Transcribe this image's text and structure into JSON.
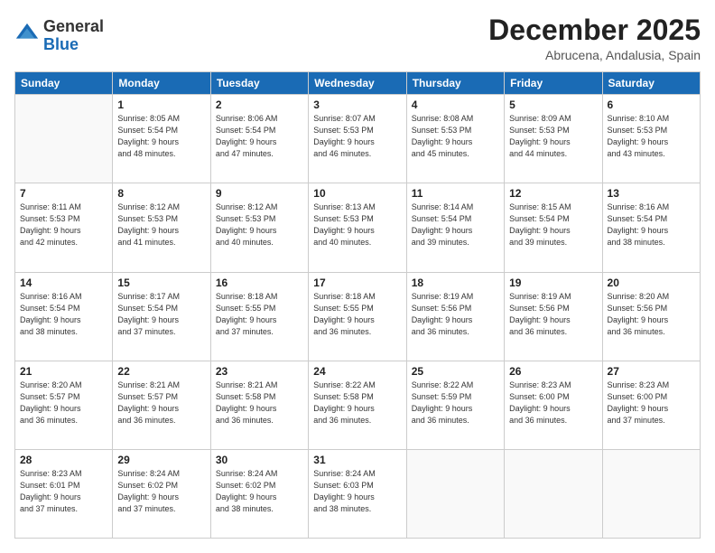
{
  "logo": {
    "general": "General",
    "blue": "Blue"
  },
  "title": "December 2025",
  "subtitle": "Abrucena, Andalusia, Spain",
  "header_days": [
    "Sunday",
    "Monday",
    "Tuesday",
    "Wednesday",
    "Thursday",
    "Friday",
    "Saturday"
  ],
  "weeks": [
    [
      {
        "day": "",
        "info": ""
      },
      {
        "day": "1",
        "info": "Sunrise: 8:05 AM\nSunset: 5:54 PM\nDaylight: 9 hours\nand 48 minutes."
      },
      {
        "day": "2",
        "info": "Sunrise: 8:06 AM\nSunset: 5:54 PM\nDaylight: 9 hours\nand 47 minutes."
      },
      {
        "day": "3",
        "info": "Sunrise: 8:07 AM\nSunset: 5:53 PM\nDaylight: 9 hours\nand 46 minutes."
      },
      {
        "day": "4",
        "info": "Sunrise: 8:08 AM\nSunset: 5:53 PM\nDaylight: 9 hours\nand 45 minutes."
      },
      {
        "day": "5",
        "info": "Sunrise: 8:09 AM\nSunset: 5:53 PM\nDaylight: 9 hours\nand 44 minutes."
      },
      {
        "day": "6",
        "info": "Sunrise: 8:10 AM\nSunset: 5:53 PM\nDaylight: 9 hours\nand 43 minutes."
      }
    ],
    [
      {
        "day": "7",
        "info": "Sunrise: 8:11 AM\nSunset: 5:53 PM\nDaylight: 9 hours\nand 42 minutes."
      },
      {
        "day": "8",
        "info": "Sunrise: 8:12 AM\nSunset: 5:53 PM\nDaylight: 9 hours\nand 41 minutes."
      },
      {
        "day": "9",
        "info": "Sunrise: 8:12 AM\nSunset: 5:53 PM\nDaylight: 9 hours\nand 40 minutes."
      },
      {
        "day": "10",
        "info": "Sunrise: 8:13 AM\nSunset: 5:53 PM\nDaylight: 9 hours\nand 40 minutes."
      },
      {
        "day": "11",
        "info": "Sunrise: 8:14 AM\nSunset: 5:54 PM\nDaylight: 9 hours\nand 39 minutes."
      },
      {
        "day": "12",
        "info": "Sunrise: 8:15 AM\nSunset: 5:54 PM\nDaylight: 9 hours\nand 39 minutes."
      },
      {
        "day": "13",
        "info": "Sunrise: 8:16 AM\nSunset: 5:54 PM\nDaylight: 9 hours\nand 38 minutes."
      }
    ],
    [
      {
        "day": "14",
        "info": "Sunrise: 8:16 AM\nSunset: 5:54 PM\nDaylight: 9 hours\nand 38 minutes."
      },
      {
        "day": "15",
        "info": "Sunrise: 8:17 AM\nSunset: 5:54 PM\nDaylight: 9 hours\nand 37 minutes."
      },
      {
        "day": "16",
        "info": "Sunrise: 8:18 AM\nSunset: 5:55 PM\nDaylight: 9 hours\nand 37 minutes."
      },
      {
        "day": "17",
        "info": "Sunrise: 8:18 AM\nSunset: 5:55 PM\nDaylight: 9 hours\nand 36 minutes."
      },
      {
        "day": "18",
        "info": "Sunrise: 8:19 AM\nSunset: 5:56 PM\nDaylight: 9 hours\nand 36 minutes."
      },
      {
        "day": "19",
        "info": "Sunrise: 8:19 AM\nSunset: 5:56 PM\nDaylight: 9 hours\nand 36 minutes."
      },
      {
        "day": "20",
        "info": "Sunrise: 8:20 AM\nSunset: 5:56 PM\nDaylight: 9 hours\nand 36 minutes."
      }
    ],
    [
      {
        "day": "21",
        "info": "Sunrise: 8:20 AM\nSunset: 5:57 PM\nDaylight: 9 hours\nand 36 minutes."
      },
      {
        "day": "22",
        "info": "Sunrise: 8:21 AM\nSunset: 5:57 PM\nDaylight: 9 hours\nand 36 minutes."
      },
      {
        "day": "23",
        "info": "Sunrise: 8:21 AM\nSunset: 5:58 PM\nDaylight: 9 hours\nand 36 minutes."
      },
      {
        "day": "24",
        "info": "Sunrise: 8:22 AM\nSunset: 5:58 PM\nDaylight: 9 hours\nand 36 minutes."
      },
      {
        "day": "25",
        "info": "Sunrise: 8:22 AM\nSunset: 5:59 PM\nDaylight: 9 hours\nand 36 minutes."
      },
      {
        "day": "26",
        "info": "Sunrise: 8:23 AM\nSunset: 6:00 PM\nDaylight: 9 hours\nand 36 minutes."
      },
      {
        "day": "27",
        "info": "Sunrise: 8:23 AM\nSunset: 6:00 PM\nDaylight: 9 hours\nand 37 minutes."
      }
    ],
    [
      {
        "day": "28",
        "info": "Sunrise: 8:23 AM\nSunset: 6:01 PM\nDaylight: 9 hours\nand 37 minutes."
      },
      {
        "day": "29",
        "info": "Sunrise: 8:24 AM\nSunset: 6:02 PM\nDaylight: 9 hours\nand 37 minutes."
      },
      {
        "day": "30",
        "info": "Sunrise: 8:24 AM\nSunset: 6:02 PM\nDaylight: 9 hours\nand 38 minutes."
      },
      {
        "day": "31",
        "info": "Sunrise: 8:24 AM\nSunset: 6:03 PM\nDaylight: 9 hours\nand 38 minutes."
      },
      {
        "day": "",
        "info": ""
      },
      {
        "day": "",
        "info": ""
      },
      {
        "day": "",
        "info": ""
      }
    ]
  ]
}
